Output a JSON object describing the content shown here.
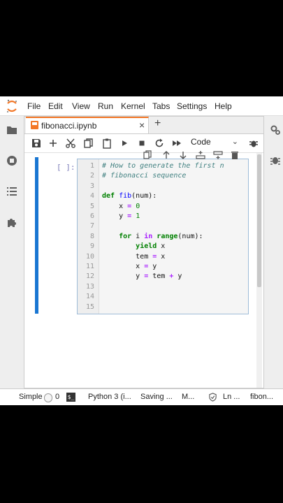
{
  "colors": {
    "accent": "#f37726",
    "cell_selected": "#1976d2",
    "comment": "#408080",
    "keyword": "#008000",
    "operator": "#aa22ff"
  },
  "menu": [
    "File",
    "Edit",
    "View",
    "Run",
    "Kernel",
    "Tabs",
    "Settings",
    "Help"
  ],
  "tab": {
    "label": "fibonacci.ipynb",
    "close": "×",
    "add": "+"
  },
  "toolbar": {
    "cell_type": "Code"
  },
  "cell": {
    "prompt": "[ ]:",
    "lines": [
      {
        "n": "1",
        "parts": [
          [
            "c-comment",
            "# How to generate the first n"
          ]
        ]
      },
      {
        "n": "2",
        "parts": [
          [
            "c-comment",
            "# fibonacci sequence"
          ]
        ]
      },
      {
        "n": "3",
        "parts": []
      },
      {
        "n": "4",
        "parts": [
          [
            "c-kw",
            "def"
          ],
          [
            "",
            " "
          ],
          [
            "c-fn",
            "fib"
          ],
          [
            "",
            "(num):"
          ]
        ]
      },
      {
        "n": "5",
        "parts": [
          [
            "",
            "    x "
          ],
          [
            "c-op",
            "="
          ],
          [
            "",
            " "
          ],
          [
            "c-num",
            "0"
          ]
        ]
      },
      {
        "n": "6",
        "parts": [
          [
            "",
            "    y "
          ],
          [
            "c-op",
            "="
          ],
          [
            "",
            " "
          ],
          [
            "c-num",
            "1"
          ]
        ]
      },
      {
        "n": "7",
        "parts": []
      },
      {
        "n": "8",
        "parts": [
          [
            "",
            "    "
          ],
          [
            "c-kw",
            "for"
          ],
          [
            "",
            " i "
          ],
          [
            "c-op",
            "in"
          ],
          [
            "",
            " "
          ],
          [
            "c-kw",
            "range"
          ],
          [
            "",
            "(num):"
          ]
        ]
      },
      {
        "n": "9",
        "parts": [
          [
            "",
            "        "
          ],
          [
            "c-kw",
            "yield"
          ],
          [
            "",
            " x"
          ]
        ]
      },
      {
        "n": "10",
        "parts": [
          [
            "",
            "        tem "
          ],
          [
            "c-op",
            "="
          ],
          [
            "",
            " x"
          ]
        ]
      },
      {
        "n": "11",
        "parts": [
          [
            "",
            "        x "
          ],
          [
            "c-op",
            "="
          ],
          [
            "",
            " y"
          ]
        ]
      },
      {
        "n": "12",
        "parts": [
          [
            "",
            "        y "
          ],
          [
            "c-op",
            "="
          ],
          [
            "",
            " tem "
          ],
          [
            "c-op",
            "+"
          ],
          [
            "",
            " y"
          ]
        ]
      },
      {
        "n": "13",
        "parts": []
      },
      {
        "n": "14",
        "parts": []
      },
      {
        "n": "15",
        "parts": []
      }
    ]
  },
  "status": {
    "mode": "Simple",
    "count": "0",
    "kernel": "Python 3 (i...",
    "saving": "Saving ...",
    "mode2": "M...",
    "position": "Ln ...",
    "file": "fibon..."
  }
}
